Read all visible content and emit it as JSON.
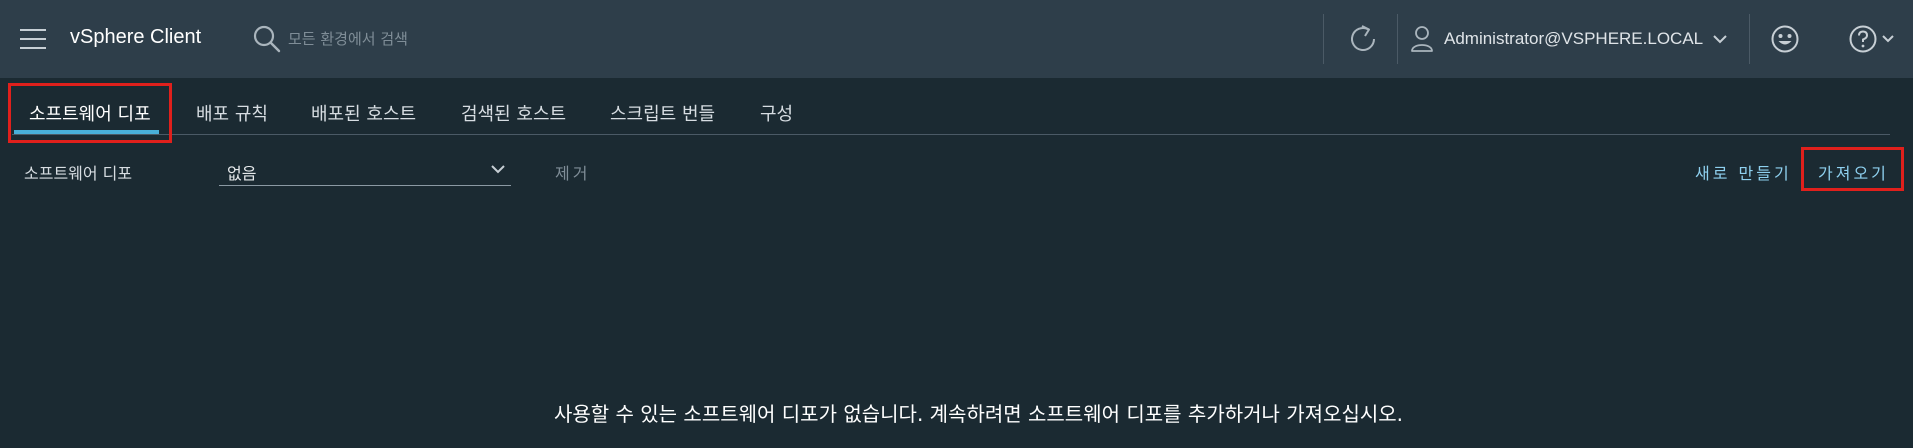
{
  "header": {
    "app_title": "vSphere Client",
    "search_placeholder": "모든 환경에서 검색",
    "user_name": "Administrator@VSPHERE.LOCAL",
    "icons": [
      "menu-icon",
      "search-icon",
      "refresh-icon",
      "user-icon",
      "chevron-down-icon",
      "smiley-icon",
      "help-icon"
    ]
  },
  "tabs": [
    {
      "label": "소프트웨어 디포",
      "active": true
    },
    {
      "label": "배포 규칙",
      "active": false
    },
    {
      "label": "배포된 호스트",
      "active": false
    },
    {
      "label": "검색된 호스트",
      "active": false
    },
    {
      "label": "스크립트 번들",
      "active": false
    },
    {
      "label": "구성",
      "active": false
    }
  ],
  "toolbar": {
    "depot_label": "소프트웨어 디포",
    "depot_selected": "없음",
    "remove_label": "제거",
    "new_label": "새로 만들기",
    "import_label": "가져오기"
  },
  "empty_message": "사용할 수 있는 소프트웨어 디포가 없습니다. 계속하려면 소프트웨어 디포를 추가하거나 가져오십시오.",
  "colors": {
    "header_bg": "#2e3e4a",
    "page_bg": "#1b2a32",
    "accent": "#49afd9",
    "link": "#8ed0ef",
    "highlight_box": "#e0201c"
  }
}
